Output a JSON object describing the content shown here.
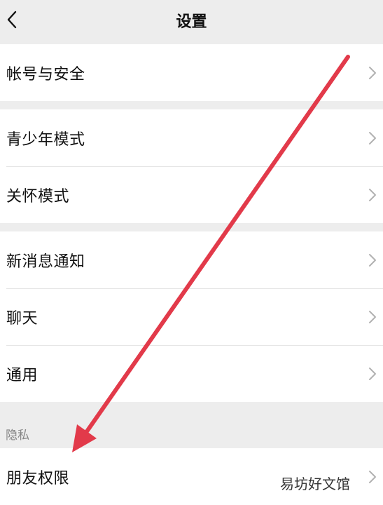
{
  "header": {
    "title": "设置",
    "back_icon": "chevron-left-icon"
  },
  "groups": {
    "account": {
      "item_0": "帐号与安全"
    },
    "modes": {
      "item_0": "青少年模式",
      "item_1": "关怀模式"
    },
    "general": {
      "item_0": "新消息通知",
      "item_1": "聊天",
      "item_2": "通用"
    },
    "privacy": {
      "section_label": "隐私",
      "item_0": "朋友权限"
    }
  },
  "annotation": {
    "arrow_color": "#e23a4a"
  },
  "watermark": "易坊好文馆",
  "colors": {
    "background": "#ededed",
    "card": "#ffffff",
    "chevron": "#b2b2b2"
  }
}
